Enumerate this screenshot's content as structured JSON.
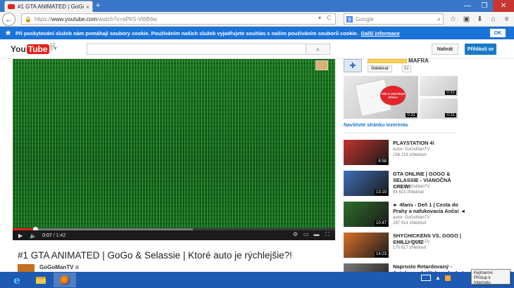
{
  "browser": {
    "tab_title": "#1 GTA ANIMATED | GoGo...",
    "tab_close": "×",
    "new_tab": "+",
    "window_controls": {
      "minimize": "—",
      "maximize": "❐",
      "close": "✕"
    },
    "url_scheme": "https://",
    "url_host": "www.youtube.com",
    "url_path": "/watch?v=sPK5-Vl6B6w",
    "search_engine": "Google",
    "search_placeholder": "Google",
    "nav_icons": [
      "star-icon",
      "clipboard-icon",
      "download-icon",
      "home-icon",
      "menu-icon"
    ]
  },
  "cookie_bar": {
    "text": "Při poskytování služeb nám pomáhají soubory cookie. Používáním našich služeb vyjadřujete souhlas s naším používáním souborů cookie.",
    "more_link": "Další informace",
    "ok_label": "OK"
  },
  "masthead": {
    "logo_you": "You",
    "logo_tube": "Tube",
    "logo_country": "CZ",
    "upload_label": "Nahrát",
    "signin_label": "Přihlásit se"
  },
  "player": {
    "current_time": "0:07",
    "duration": "1:42",
    "played_fraction": 0.07,
    "loaded_fraction": 0.56
  },
  "video": {
    "title": "#1 GTA ANIMATED | GoGo & Selassie | Ktoré auto je rýchlejšie?!",
    "channel": "GoGoManTV"
  },
  "ad": {
    "brand": "MAFRA",
    "unsubscribe_label": "Odebírat",
    "subscriber_count": "92",
    "big_thumb_text": "VŠE O CENTRUM ZPRÁV",
    "big_duration": "0:31",
    "small_durations": [
      "0:31",
      "0:31"
    ],
    "link": "Navštivte stránku inzerenta"
  },
  "related": [
    {
      "title": "PLAYSTATION 4!",
      "author": "autor: GoGoManTV",
      "views": "158 218 zhlédnutí",
      "duration": "8:58",
      "color": "#c2332e"
    },
    {
      "title": "GTA ONLINE | GOGO & SELASSIE - VIANOČNÁ CREW!",
      "author": "autor: GoGoManTV",
      "views": "84 623 zhlédnutí",
      "duration": "13:19",
      "color": "#3f6fb8"
    },
    {
      "title": "► 4fans - Deň 1 | Cesta do Prahy a nafukovacia Anča! ◄",
      "author": "autor: GoGoManTV",
      "views": "287 914 zhlédnutí",
      "duration": "10:47",
      "color": "#2d6e2a"
    },
    {
      "title": "SHYCHICKENS VS. GOGO | CHILLI QUIZ",
      "author": "autor: GoGoManTV",
      "views": "170 817 zhlédnutí",
      "duration": "14:23",
      "color": "#d8702a"
    },
    {
      "title": "Naprosto Retardovaný - Autobus vyletěl do vzduchu! TV/Dolan",
      "author": "",
      "views": "",
      "duration": "",
      "color": "#7a7a7a"
    }
  ],
  "taskbar": {
    "clock_date": "6. 1. 2015",
    "tooltip_line1": "Kejmarovi",
    "tooltip_line2": "Přístup k Internetu"
  }
}
